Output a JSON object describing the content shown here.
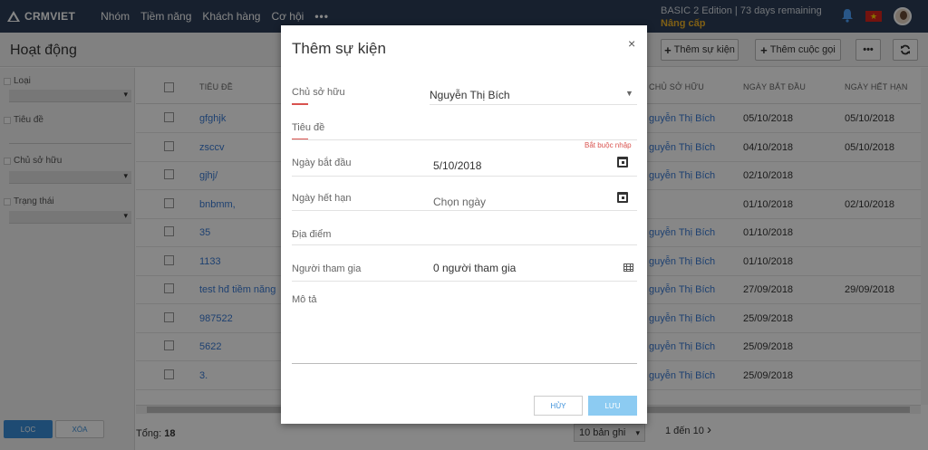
{
  "app": {
    "logo": "CRMVIET",
    "nav": [
      "Nhóm",
      "Tiềm năng",
      "Khách hàng",
      "Cơ hội"
    ],
    "nav_more": "•••",
    "edition": "BASIC 2 Edition | 73 days remaining",
    "upgrade": "Nâng cấp"
  },
  "header": {
    "title": "Hoạt động",
    "add_task": "Thêm sự kiện",
    "add_call": "Thêm cuộc gọi",
    "more": "•••"
  },
  "filters": {
    "type": "Loại",
    "title": "Tiêu đề",
    "owner": "Chủ sở hữu",
    "status": "Trạng thái",
    "filter_btn": "LỌC",
    "clear_btn": "XÓA"
  },
  "table": {
    "headers": [
      "TIÊU ĐỀ",
      "CHỦ SỞ HỮU",
      "NGÀY BẮT ĐẦU",
      "NGÀY HẾT HẠN"
    ],
    "rows": [
      {
        "title": "gfghjk",
        "owner": "guyễn Thị Bích",
        "start": "05/10/2018",
        "end": "05/10/2018"
      },
      {
        "title": "zsccv",
        "owner": "guyễn Thị Bích",
        "start": "04/10/2018",
        "end": "05/10/2018"
      },
      {
        "title": "gjhj/",
        "owner": "guyễn Thị Bích",
        "start": "02/10/2018",
        "end": ""
      },
      {
        "title": "bnbmm,",
        "owner": "",
        "start": "01/10/2018",
        "end": "02/10/2018"
      },
      {
        "title": "35",
        "owner": "guyễn Thị Bích",
        "start": "01/10/2018",
        "end": ""
      },
      {
        "title": "1133",
        "owner": "guyễn Thị Bích",
        "start": "01/10/2018",
        "end": ""
      },
      {
        "title": "test hđ tiềm năng",
        "owner": "guyễn Thị Bích",
        "start": "27/09/2018",
        "end": "29/09/2018"
      },
      {
        "title": "987522",
        "owner": "guyễn Thị Bích",
        "start": "25/09/2018",
        "end": ""
      },
      {
        "title": "5622",
        "owner": "guyễn Thị Bích",
        "start": "25/09/2018",
        "end": ""
      },
      {
        "title": "3.",
        "owner": "guyễn Thị Bích",
        "start": "25/09/2018",
        "end": ""
      }
    ]
  },
  "footer": {
    "total_label": "Tổng:",
    "total_value": "18",
    "page_size": "10 bản ghi",
    "page_info": "1 đến 10",
    "next": "›"
  },
  "modal": {
    "title": "Thêm sự kiện",
    "close": "×",
    "owner_label": "Chủ sở hữu",
    "owner_value": "Nguyễn Thị Bích",
    "title_label": "Tiêu đề",
    "required": "Bắt buộc nhập",
    "start_label": "Ngày bắt đầu",
    "start_value": "5/10/2018",
    "end_label": "Ngày hết hạn",
    "end_placeholder": "Chọn ngày",
    "location_label": "Địa điểm",
    "participants_label": "Người tham gia",
    "participants_value": "0 người tham gia",
    "description_label": "Mô tả",
    "cancel": "HỦY",
    "save": "LƯU"
  },
  "colors": {
    "nav_bg": "#2c3e57",
    "accent": "#3a8fd9",
    "required": "#d9534f",
    "upgrade": "#f0b429"
  }
}
